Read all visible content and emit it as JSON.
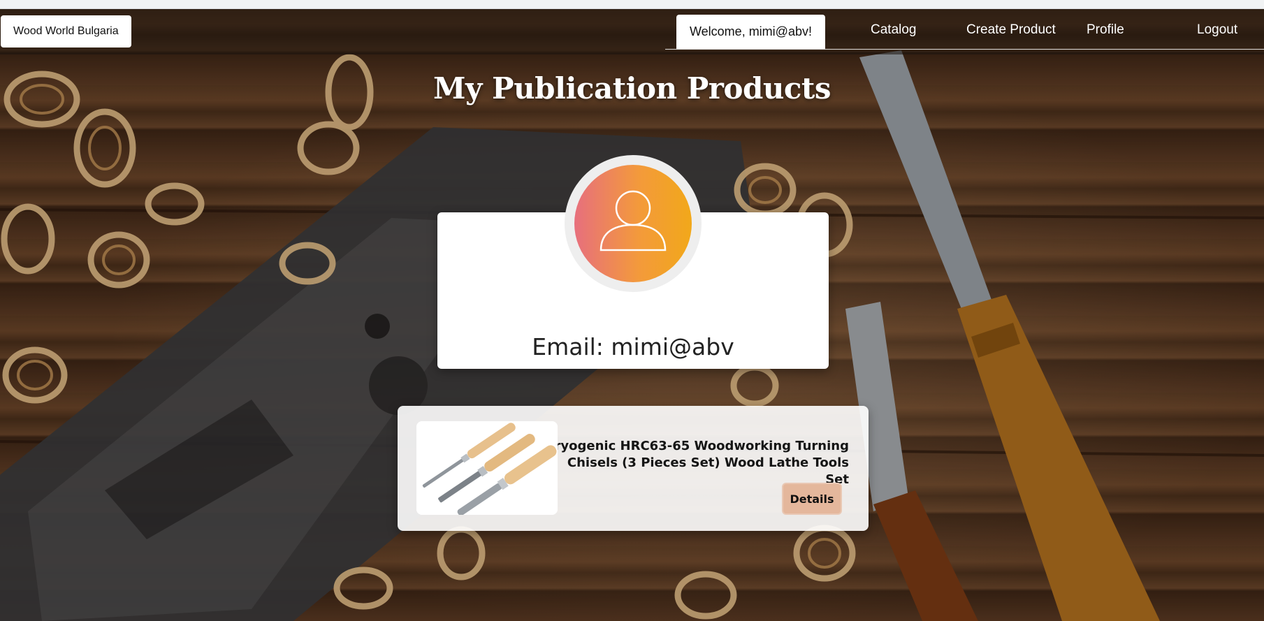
{
  "nav": {
    "brand": "Wood World Bulgaria",
    "welcome": "Welcome, mimi@abv!",
    "links": {
      "catalog": "Catalog",
      "create_product": "Create Product",
      "profile": "Profile",
      "logout": "Logout"
    }
  },
  "page": {
    "title": "My Publication Products"
  },
  "profile": {
    "avatar_icon": "user-icon",
    "email_text": "Email: mimi@abv"
  },
  "products": [
    {
      "name": "ryogenic HRC63-65 Woodworking Turning\nChisels (3 Pieces Set) Wood Lathe Tools Set",
      "image_icon": "chisel-set-image",
      "details_label": "Details"
    }
  ],
  "colors": {
    "avatar_gradient": [
      "#e76f7d",
      "#f39a3b",
      "#f2a81a"
    ],
    "details_button": "#e4b79c",
    "wood_background": "#5a3a22"
  }
}
